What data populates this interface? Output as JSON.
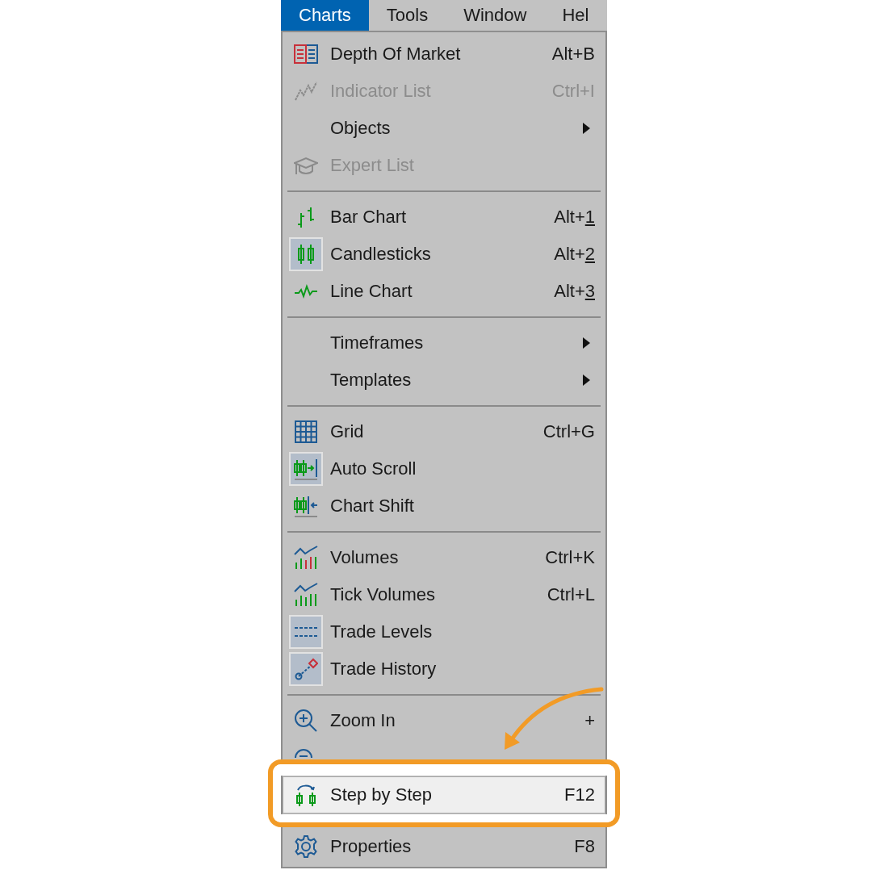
{
  "menu_bar": [
    {
      "label": "Charts",
      "selected": true
    },
    {
      "label": "Tools",
      "selected": false
    },
    {
      "label": "Window",
      "selected": false
    },
    {
      "label": "Hel",
      "selected": false
    }
  ],
  "menu": {
    "groups": [
      [
        {
          "label": "Depth Of Market",
          "shortcut": "Alt+B",
          "disabled": false,
          "checked": false,
          "submenu": false,
          "highlighted": false
        },
        {
          "label": "Indicator List",
          "shortcut": "Ctrl+I",
          "disabled": true,
          "checked": false,
          "submenu": false,
          "highlighted": false
        },
        {
          "label": "Objects",
          "disabled": false,
          "checked": false,
          "submenu": true,
          "highlighted": false
        },
        {
          "label": "Expert List",
          "disabled": true,
          "checked": false,
          "submenu": false,
          "highlighted": false
        }
      ],
      [
        {
          "label": "Bar Chart",
          "shortcut": "Alt+1",
          "shortcut_underlined": true,
          "disabled": false,
          "checked": false,
          "submenu": false,
          "highlighted": false
        },
        {
          "label": "Candlesticks",
          "shortcut": "Alt+2",
          "shortcut_underlined": true,
          "disabled": false,
          "checked": true,
          "submenu": false,
          "highlighted": false
        },
        {
          "label": "Line Chart",
          "shortcut": "Alt+3",
          "shortcut_underlined": true,
          "disabled": false,
          "checked": false,
          "submenu": false,
          "highlighted": false
        }
      ],
      [
        {
          "label": "Timeframes",
          "disabled": false,
          "checked": false,
          "submenu": true,
          "highlighted": false
        },
        {
          "label": "Templates",
          "disabled": false,
          "checked": false,
          "submenu": true,
          "highlighted": false
        }
      ],
      [
        {
          "label": "Grid",
          "shortcut": "Ctrl+G",
          "disabled": false,
          "checked": false,
          "submenu": false,
          "highlighted": false
        },
        {
          "label": "Auto Scroll",
          "disabled": false,
          "checked": true,
          "submenu": false,
          "highlighted": false
        },
        {
          "label": "Chart Shift",
          "disabled": false,
          "checked": false,
          "submenu": false,
          "highlighted": false
        }
      ],
      [
        {
          "label": "Volumes",
          "shortcut": "Ctrl+K",
          "disabled": false,
          "checked": false,
          "submenu": false,
          "highlighted": false
        },
        {
          "label": "Tick Volumes",
          "shortcut": "Ctrl+L",
          "disabled": false,
          "checked": false,
          "submenu": false,
          "highlighted": false
        },
        {
          "label": "Trade Levels",
          "disabled": false,
          "checked": true,
          "submenu": false,
          "highlighted": false
        },
        {
          "label": "Trade History",
          "disabled": false,
          "checked": true,
          "submenu": false,
          "highlighted": false
        }
      ],
      [
        {
          "label": "Zoom In",
          "shortcut": "+",
          "disabled": false,
          "checked": false,
          "submenu": false,
          "highlighted": false
        },
        {
          "checked": false,
          "submenu": false,
          "highlighted": false
        },
        {
          "label": "Step by Step",
          "shortcut": "F12",
          "disabled": false,
          "checked": false,
          "submenu": false,
          "highlighted": true,
          "callout": true
        }
      ],
      [
        {
          "label": "Properties",
          "shortcut": "F8",
          "disabled": false,
          "checked": false,
          "submenu": false,
          "highlighted": false
        }
      ]
    ]
  }
}
